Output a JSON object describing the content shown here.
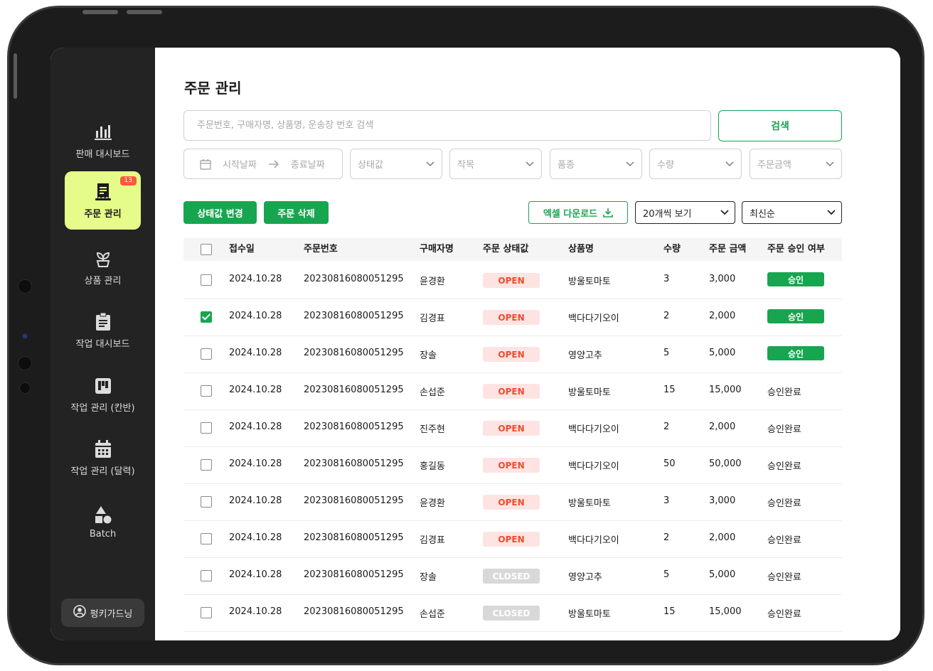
{
  "sidebar": {
    "items": [
      {
        "key": "sales-dashboard",
        "label": "판매 대시보드",
        "icon": "bar-chart-icon",
        "active": false
      },
      {
        "key": "order-management",
        "label": "주문 관리",
        "icon": "receipt-icon",
        "active": true,
        "badge": "13"
      },
      {
        "key": "product-management",
        "label": "상품 관리",
        "icon": "plant-pot-icon",
        "active": false
      },
      {
        "key": "work-dashboard",
        "label": "작업 대시보드",
        "icon": "clipboard-icon",
        "active": false
      },
      {
        "key": "work-kanban",
        "label": "작업 관리 (칸반)",
        "icon": "kanban-icon",
        "active": false
      },
      {
        "key": "work-calendar",
        "label": "작업 관리 (달력)",
        "icon": "calendar-icon",
        "active": false
      },
      {
        "key": "batch",
        "label": "Batch",
        "icon": "shapes-icon",
        "active": false
      }
    ],
    "user": {
      "name": "펑키가드닝",
      "icon": "user-circle-icon"
    }
  },
  "page": {
    "title": "주문 관리"
  },
  "search": {
    "placeholder": "주문번호, 구매자명, 상품명, 운송장 번호 검색",
    "value": "",
    "button": "검색"
  },
  "filters": {
    "date_start": "시작날짜",
    "date_end": "종료날짜",
    "status": "상태값",
    "crop": "작목",
    "variety": "품종",
    "quantity": "수량",
    "amount": "주문금액"
  },
  "actions": {
    "change_status": "상태값 변경",
    "delete_order": "주문 삭제",
    "excel_download": "엑셀 다운로드",
    "page_size": "20개씩 보기",
    "sort": "최신순"
  },
  "table": {
    "headers": {
      "date": "접수일",
      "order_no": "주문번호",
      "buyer": "구매자명",
      "status": "주문 상태값",
      "product": "상품명",
      "qty": "수량",
      "amount": "주문 금액",
      "approval": "주문 승인 여부"
    },
    "rows": [
      {
        "checked": false,
        "date": "2024.10.28",
        "order_no": "20230816080051295",
        "buyer": "윤경환",
        "status": "OPEN",
        "product": "방울토마토",
        "qty": "3",
        "amount": "3,000",
        "approval": "승인",
        "approval_type": "button"
      },
      {
        "checked": true,
        "date": "2024.10.28",
        "order_no": "20230816080051295",
        "buyer": "김경표",
        "status": "OPEN",
        "product": "백다다기오이",
        "qty": "2",
        "amount": "2,000",
        "approval": "승인",
        "approval_type": "button"
      },
      {
        "checked": false,
        "date": "2024.10.28",
        "order_no": "20230816080051295",
        "buyer": "장솔",
        "status": "OPEN",
        "product": "영양고추",
        "qty": "5",
        "amount": "5,000",
        "approval": "승인",
        "approval_type": "button"
      },
      {
        "checked": false,
        "date": "2024.10.28",
        "order_no": "20230816080051295",
        "buyer": "손섭준",
        "status": "OPEN",
        "product": "방울토마토",
        "qty": "15",
        "amount": "15,000",
        "approval": "승인완료",
        "approval_type": "text"
      },
      {
        "checked": false,
        "date": "2024.10.28",
        "order_no": "20230816080051295",
        "buyer": "진주현",
        "status": "OPEN",
        "product": "백다다기오이",
        "qty": "2",
        "amount": "2,000",
        "approval": "승인완료",
        "approval_type": "text"
      },
      {
        "checked": false,
        "date": "2024.10.28",
        "order_no": "20230816080051295",
        "buyer": "홍길동",
        "status": "OPEN",
        "product": "백다다기오이",
        "qty": "50",
        "amount": "50,000",
        "approval": "승인완료",
        "approval_type": "text"
      },
      {
        "checked": false,
        "date": "2024.10.28",
        "order_no": "20230816080051295",
        "buyer": "윤경환",
        "status": "OPEN",
        "product": "방울토마토",
        "qty": "3",
        "amount": "3,000",
        "approval": "승인완료",
        "approval_type": "text"
      },
      {
        "checked": false,
        "date": "2024.10.28",
        "order_no": "20230816080051295",
        "buyer": "김경표",
        "status": "OPEN",
        "product": "백다다기오이",
        "qty": "2",
        "amount": "2,000",
        "approval": "승인완료",
        "approval_type": "text"
      },
      {
        "checked": false,
        "date": "2024.10.28",
        "order_no": "20230816080051295",
        "buyer": "장솔",
        "status": "CLOSED",
        "product": "영양고추",
        "qty": "5",
        "amount": "5,000",
        "approval": "승인완료",
        "approval_type": "text"
      },
      {
        "checked": false,
        "date": "2024.10.28",
        "order_no": "20230816080051295",
        "buyer": "손섭준",
        "status": "CLOSED",
        "product": "방울토마토",
        "qty": "15",
        "amount": "15,000",
        "approval": "승인완료",
        "approval_type": "text"
      }
    ]
  },
  "colors": {
    "accent": "#18a550",
    "active_nav": "#e6fc8a",
    "open_text": "#f04b2e",
    "open_bg": "#fde4e2",
    "closed_bg": "#d8d8d8",
    "badge": "#ff5a3a",
    "sidebar_bg": "#232323"
  }
}
